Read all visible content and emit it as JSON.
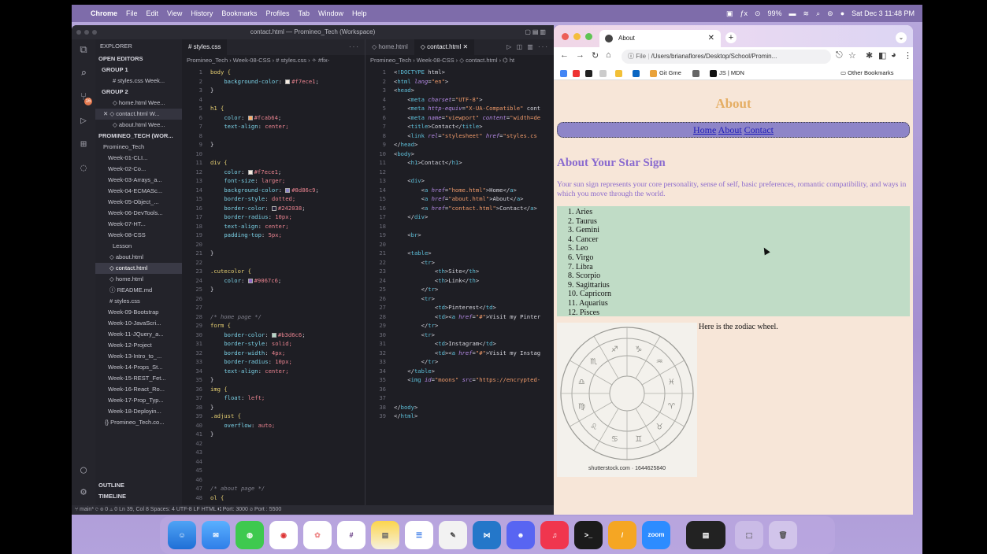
{
  "menubar": {
    "app": "Chrome",
    "items": [
      "File",
      "Edit",
      "View",
      "History",
      "Bookmarks",
      "Profiles",
      "Tab",
      "Window",
      "Help"
    ],
    "battery": "99%",
    "datetime": "Sat Dec 3  11:48 PM"
  },
  "vscode": {
    "title": "contact.html — Promineo_Tech (Workspace)",
    "explorer": {
      "header": "EXPLORER",
      "open_editors": "OPEN EDITORS",
      "group1": "GROUP 1",
      "g1_file": "# styles.css  Week...",
      "group2": "GROUP 2",
      "g2_home": "◇ home.html  Wee...",
      "g2_contact": "✕  ◇ contact.html  W...",
      "g2_about": "◇ about.html  Wee...",
      "workspace": "PROMINEO_TECH (WOR...",
      "root": "Promineo_Tech",
      "folders": [
        "Week-01-CLI...",
        "Week-02-Co...",
        "Week-03-Arrays_a...",
        "Week-04-ECMASc...",
        "Week-05-Object_...",
        "Week-06-DevTools...",
        "Week-07-HT...",
        "Week-08-CSS"
      ],
      "lesson": "Lesson",
      "files": [
        "◇ about.html",
        "◇ contact.html",
        "◇ home.html",
        "ⓘ README.md",
        "# styles.css"
      ],
      "folders2": [
        "Week-09-Bootstrap",
        "Week-10-JavaScri...",
        "Week-11-JQuery_a...",
        "Week-12-Project",
        "Week-13-Intro_to_...",
        "Week-14-Props_St...",
        "Week-15-REST_Fet...",
        "Week-16-React_Ro...",
        "Week-17-Prop_Typ...",
        "Week-18-Deployin..."
      ],
      "workspace_file": "{} Promineo_Tech.co...",
      "outline": "OUTLINE",
      "timeline": "TIMELINE"
    },
    "editor1": {
      "tab": "# styles.css",
      "crumbs": "Promineo_Tech › Week-08-CSS › # styles.css › ✧ #fix-",
      "lines": [
        "body {",
        "    background-color: #f7ece1;",
        "}",
        "",
        "h1 {",
        "    color: #fcab64;",
        "    text-align: center;",
        "",
        "}",
        "",
        "div {",
        "    color: #f7ece1;",
        "    font-size: larger;",
        "    background-color: #8d86c9;",
        "    border-style: dotted;",
        "    border-color: #242038;",
        "    border-radius: 10px;",
        "    text-align: center;",
        "    padding-top: 5px;",
        "",
        "}",
        "",
        ".cutecolor {",
        "    color: #9067c6;",
        "}",
        "",
        "",
        "/* home page */",
        "form {",
        "    border-color: #b3d6c6;",
        "    border-style: solid;",
        "    border-width: 4px;",
        "    border-radius: 10px;",
        "    text-align: center;",
        "}",
        "img {",
        "    float: left;",
        "}",
        ".adjust {",
        "    overflow: auto;",
        "}",
        "",
        "",
        "",
        "",
        "",
        "/* about page */",
        "ol {"
      ]
    },
    "editor2": {
      "tab_home": "◇ home.html",
      "tab_contact": "◇ contact.html ✕",
      "crumbs": "Promineo_Tech › Week-08-CSS › ◇ contact.html › ⌬ ht",
      "lines": [
        "<!DOCTYPE html>",
        "<html lang=\"en\">",
        "<head>",
        "    <meta charset=\"UTF-8\">",
        "    <meta http-equiv=\"X-UA-Compatible\" cont",
        "    <meta name=\"viewport\" content=\"width=de",
        "    <title>Contact</title>",
        "    <link rel=\"stylesheet\" href=\"styles.cs",
        "</head>",
        "<body>",
        "    <h1>Contact</h1>",
        "",
        "    <div>",
        "        <a href=\"home.html\">Home</a>",
        "        <a href=\"about.html\">About</a>",
        "        <a href=\"contact.html\">Contact</a>",
        "    </div>",
        "",
        "    <br>",
        "",
        "    <table>",
        "        <tr>",
        "            <th>Site</th>",
        "            <th>Link</th>",
        "        </tr>",
        "        <tr>",
        "            <td>Pinterest</td>",
        "            <td><a href=\"#\">Visit my Pinter",
        "        </tr>",
        "        <tr>",
        "            <td>Instagram</td>",
        "            <td><a href=\"#\">Visit my Instag",
        "        </tr>",
        "    </table>",
        "    <img id=\"moons\" src=\"https://encrypted-",
        "",
        "",
        "</body>",
        "</html>"
      ]
    },
    "status": "⑂ main*   ⟳   ⊗ 0 ⚠ 0                                                   Ln 39, Col 8   Spaces: 4   UTF-8   LF   HTML   ⑆ Port: 3000   ⊘ Port : 5500"
  },
  "chrome": {
    "tab_title": "About",
    "url_scheme": "File",
    "url": "/Users/brianaflores/Desktop/School/Promin...",
    "bookmarks": [
      "Git Gme",
      "JS | MDN"
    ],
    "other_bookmarks": "Other Bookmarks",
    "page": {
      "h1": "About",
      "nav": [
        "Home",
        "About",
        "Contact"
      ],
      "h2": "About Your Star Sign",
      "paragraph": "Your sun sign represents your core personality, sense of self, basic preferences, romantic compatibility, and ways in which you move through the world.",
      "signs": [
        "Aries",
        "Taurus",
        "Gemini",
        "Cancer",
        "Leo",
        "Virgo",
        "Libra",
        "Scorpio",
        "Sagittarius",
        "Capricorn",
        "Aquarius",
        "Pisces"
      ],
      "image_caption": "shutterstock.com · 1644625840",
      "wheel_text": "Here is the zodiac wheel."
    }
  },
  "dock": {
    "zoom_label": "zoom"
  },
  "colors": {
    "page_bg": "#f7ece1",
    "h1": "#fcab64",
    "nav_bg": "#8d86c9",
    "accent": "#9067c6",
    "list_bg": "#b3d6c6"
  }
}
